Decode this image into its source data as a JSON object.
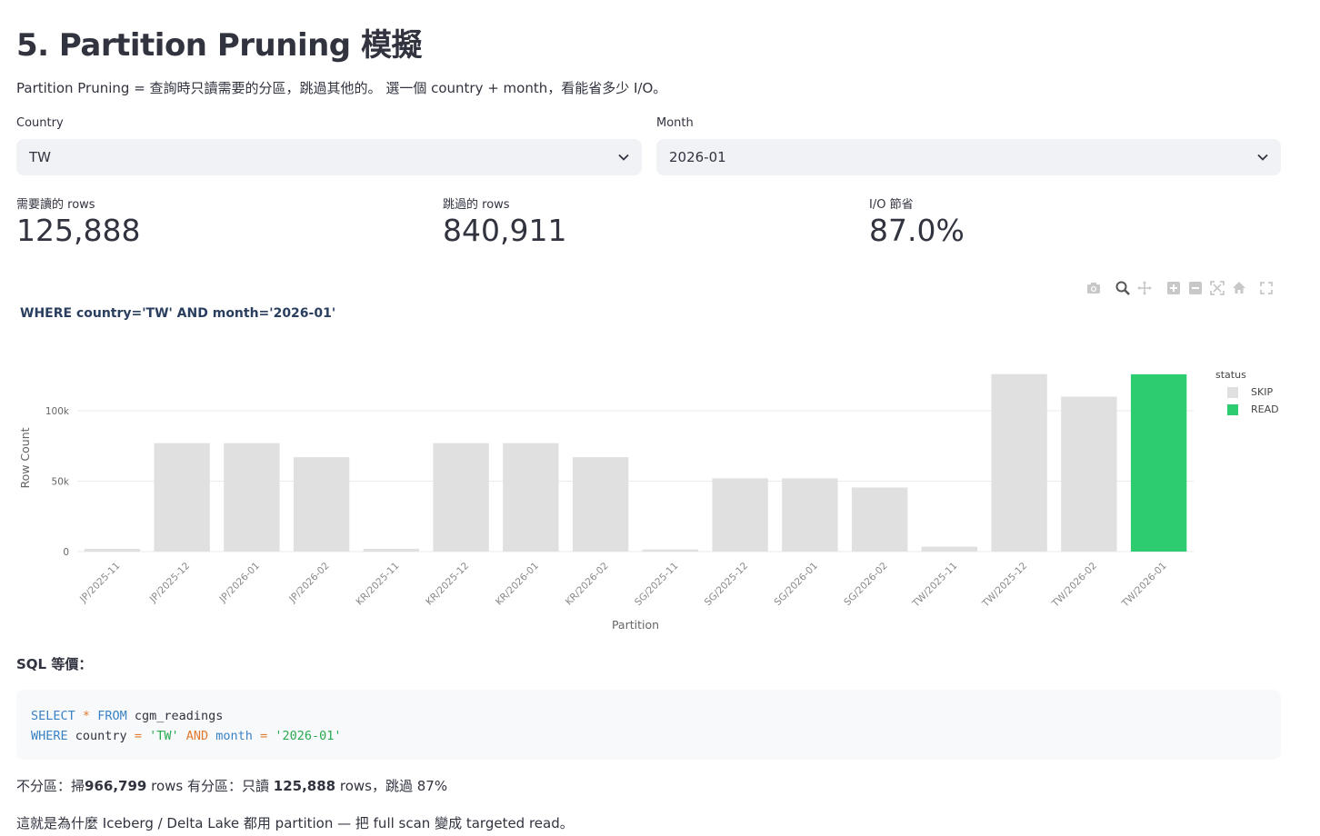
{
  "header": {
    "title": "5. Partition Pruning 模擬",
    "intro": "Partition Pruning = 查詢時只讀需要的分區，跳過其他的。 選一個 country + month，看能省多少 I/O。"
  },
  "filters": {
    "country_label": "Country",
    "country_value": "TW",
    "month_label": "Month",
    "month_value": "2026-01"
  },
  "metrics": [
    {
      "label": "需要讀的 rows",
      "value": "125,888"
    },
    {
      "label": "跳過的 rows",
      "value": "840,911"
    },
    {
      "label": "I/O 節省",
      "value": "87.0%"
    }
  ],
  "modebar_icons": [
    "camera-icon",
    "zoom-icon",
    "pan-icon",
    "zoom-in-icon",
    "zoom-out-icon",
    "autoscale-icon",
    "home-icon",
    "fullscreen-icon"
  ],
  "chart_data": {
    "type": "bar",
    "title": "WHERE country='TW' AND month='2026-01'",
    "xlabel": "Partition",
    "ylabel": "Row Count",
    "categories": [
      "JP/2025-11",
      "JP/2025-12",
      "JP/2026-01",
      "JP/2026-02",
      "KR/2025-11",
      "KR/2025-12",
      "KR/2026-01",
      "KR/2026-02",
      "SG/2025-11",
      "SG/2025-12",
      "SG/2026-01",
      "SG/2026-02",
      "TW/2025-11",
      "TW/2025-12",
      "TW/2026-02",
      "TW/2026-01"
    ],
    "values": [
      2000,
      77000,
      77000,
      67000,
      2000,
      77000,
      77000,
      67000,
      1500,
      52000,
      52000,
      45500,
      3500,
      126000,
      110000,
      125888
    ],
    "status": [
      "SKIP",
      "SKIP",
      "SKIP",
      "SKIP",
      "SKIP",
      "SKIP",
      "SKIP",
      "SKIP",
      "SKIP",
      "SKIP",
      "SKIP",
      "SKIP",
      "SKIP",
      "SKIP",
      "SKIP",
      "READ"
    ],
    "yticks": [
      0,
      50000,
      100000
    ],
    "ytick_labels": [
      "0",
      "50k",
      "100k"
    ],
    "ylim": [
      0,
      132500
    ],
    "legend": {
      "title": "status",
      "position": "top-right",
      "entries": [
        {
          "name": "SKIP",
          "color": "#e0e0e0"
        },
        {
          "name": "READ",
          "color": "#2ecc71"
        }
      ]
    },
    "grid": true
  },
  "sql": {
    "heading": "SQL 等價：",
    "line1": {
      "k1": "SELECT",
      "op": "*",
      "k2": "FROM",
      "table": "cgm_readings"
    },
    "line2": {
      "k1": "WHERE",
      "c1": "country",
      "eq1": "=",
      "v1": "'TW'",
      "and": "AND",
      "c2": "month",
      "eq2": "=",
      "v2": "'2026-01'"
    }
  },
  "summary": {
    "part1": "不分區：掃",
    "full_rows": "966,799",
    "part2": "rows 有分區：只讀",
    "read_rows": "125,888",
    "part3": "rows，跳過 87%"
  },
  "footer": "這就是為什麼 Iceberg / Delta Lake 都用 partition — 把 full scan 變成 targeted read。"
}
